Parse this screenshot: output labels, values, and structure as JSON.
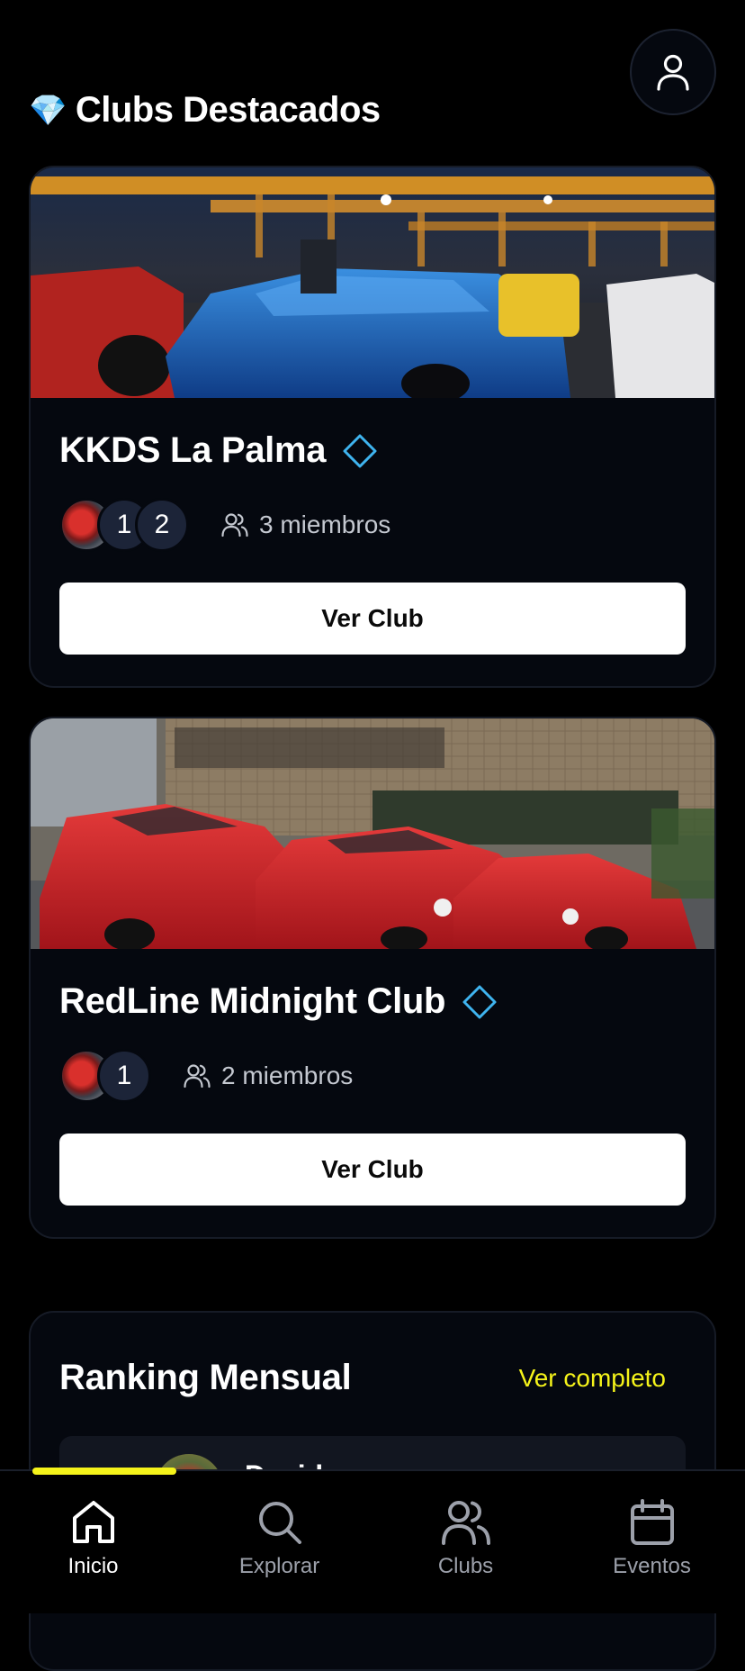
{
  "header": {
    "section_icon": "gem-icon",
    "section_emoji": "💎",
    "section_title": "Clubs Destacados",
    "profile_icon": "user-icon"
  },
  "clubs": [
    {
      "name": "KKDS La Palma",
      "badge_icon": "diamond-outline-icon",
      "avatars": [
        "",
        "1",
        "2"
      ],
      "members_label": "3 miembros",
      "cta_label": "Ver Club"
    },
    {
      "name": "RedLine Midnight Club",
      "badge_icon": "diamond-outline-icon",
      "avatars": [
        "",
        "1"
      ],
      "members_label": "2 miembros",
      "cta_label": "Ver Club"
    }
  ],
  "ranking": {
    "title": "Ranking Mensual",
    "link_label": "Ver completo",
    "first_entry_name": "David"
  },
  "nav": {
    "items": [
      {
        "label": "Inicio",
        "icon": "home-icon",
        "active": true
      },
      {
        "label": "Explorar",
        "icon": "search-icon",
        "active": false
      },
      {
        "label": "Clubs",
        "icon": "users-icon",
        "active": false
      },
      {
        "label": "Eventos",
        "icon": "calendar-icon",
        "active": false
      }
    ]
  },
  "colors": {
    "accent_yellow": "#f5f31a",
    "badge_blue": "#3fb4ef",
    "card_bg": "#05080f"
  }
}
